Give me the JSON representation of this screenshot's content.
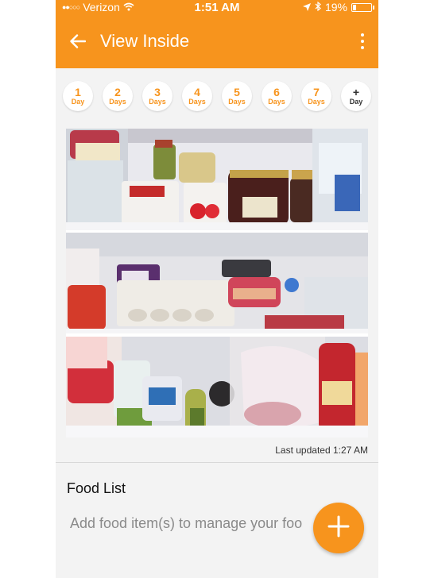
{
  "status_bar": {
    "carrier": "Verizon",
    "time": "1:51 AM",
    "battery": "19%",
    "battery_level": 0.19
  },
  "app_bar": {
    "title": "View Inside"
  },
  "day_selector": [
    {
      "number": "1",
      "unit": "Day"
    },
    {
      "number": "2",
      "unit": "Days"
    },
    {
      "number": "3",
      "unit": "Days"
    },
    {
      "number": "4",
      "unit": "Days"
    },
    {
      "number": "5",
      "unit": "Days"
    },
    {
      "number": "6",
      "unit": "Days"
    },
    {
      "number": "7",
      "unit": "Days"
    },
    {
      "number": "+",
      "unit": "Day"
    }
  ],
  "camera": {
    "last_updated": "Last updated 1:27 AM"
  },
  "food_list": {
    "heading": "Food List",
    "placeholder": "Add food item(s) to manage your foo"
  },
  "colors": {
    "accent": "#f7941d",
    "background": "#f3f3f3"
  },
  "icons": {
    "back": "arrow-left-icon",
    "menu": "more-vertical-icon",
    "add": "plus-icon",
    "location": "location-arrow-icon",
    "bluetooth": "bluetooth-icon",
    "wifi": "wifi-icon"
  }
}
